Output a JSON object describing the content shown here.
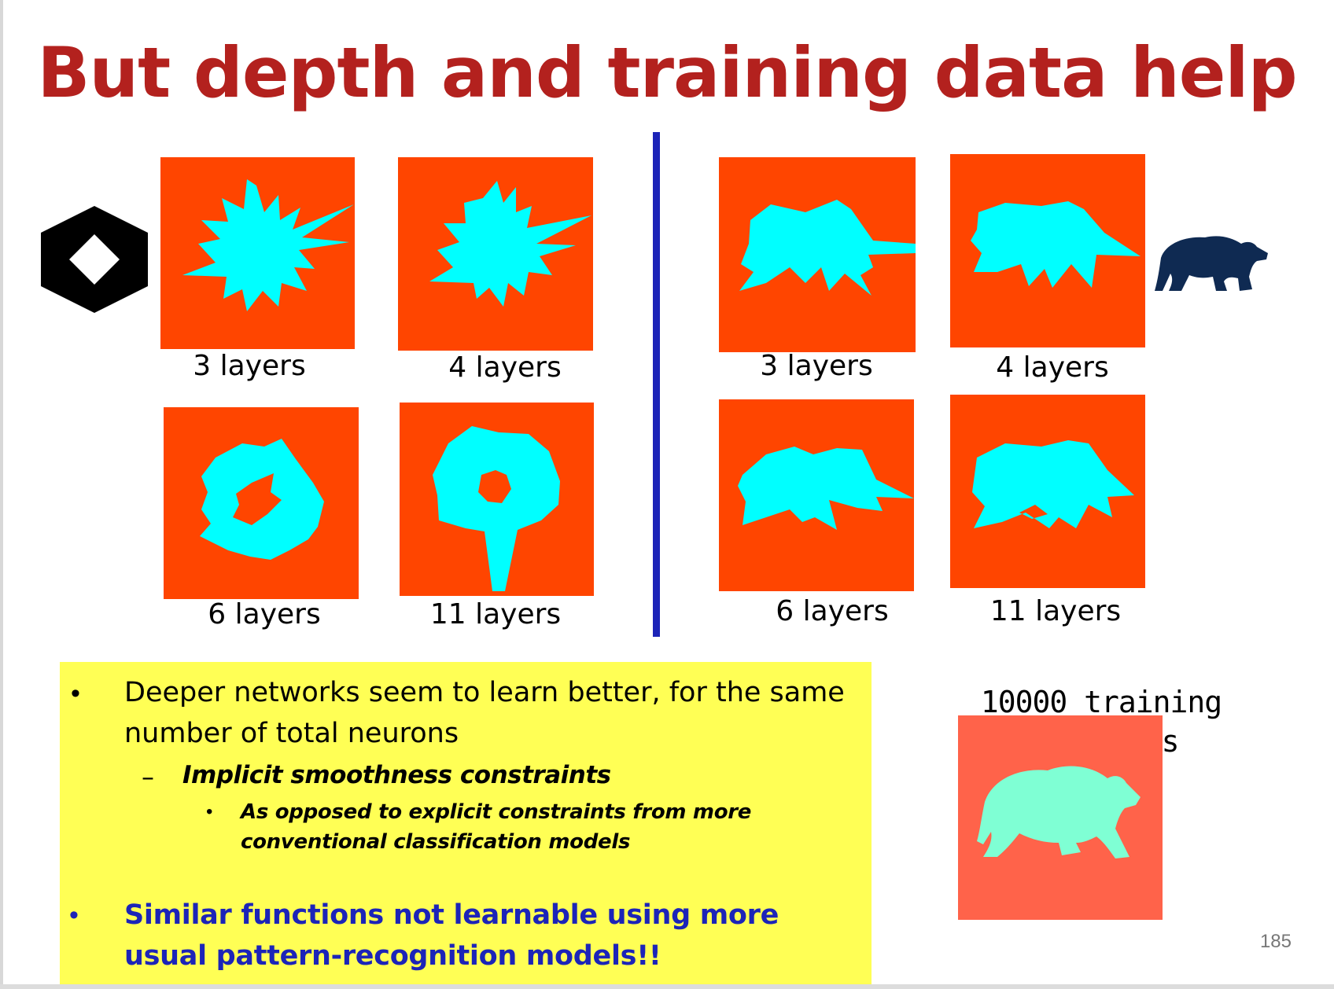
{
  "slide": {
    "title": "But depth and training data help",
    "page_number": "185",
    "colors": {
      "title": "#b3211e",
      "tile_background": "#ff4500",
      "shape_fill": "#00ffff",
      "divider": "#1c24b8",
      "highlight_box": "#ffff55",
      "bear_icon": "#0f2a52"
    }
  },
  "left_panel": {
    "target_icon": "hexagon-with-diamond-hole-icon",
    "tiles": [
      {
        "caption": "3 layers"
      },
      {
        "caption": "4 layers"
      },
      {
        "caption": "6 layers"
      },
      {
        "caption": "11 layers"
      }
    ]
  },
  "right_panel": {
    "target_icon": "bear-icon",
    "tiles": [
      {
        "caption": "3 layers"
      },
      {
        "caption": "4 layers"
      },
      {
        "caption": "6 layers"
      },
      {
        "caption": "11 layers"
      }
    ],
    "training": {
      "label": "10000 training instances"
    }
  },
  "bullets": {
    "b1": "Deeper networks seem to learn better, for the same number of total neurons",
    "b1_sub": "Implicit smoothness constraints",
    "b1_sub_sub": "As opposed to explicit constraints from more conventional classification models",
    "b2": "Similar functions not learnable using more usual pattern-recognition models!!",
    "dot": "•",
    "dash": "–"
  }
}
